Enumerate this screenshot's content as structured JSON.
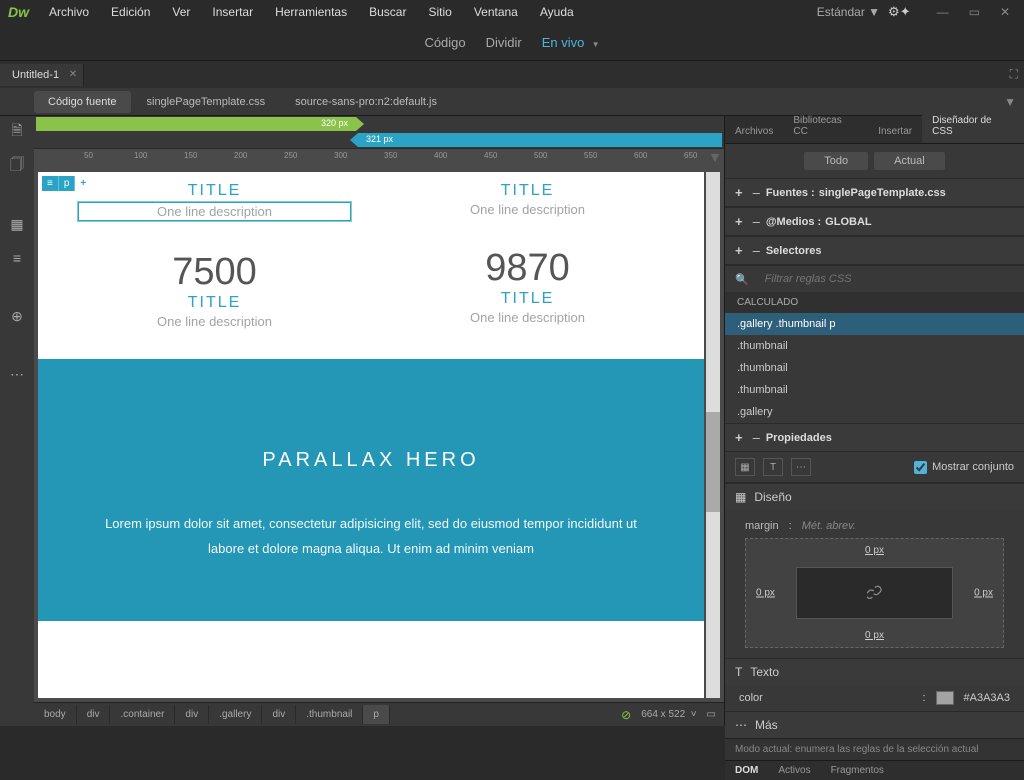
{
  "app": {
    "logo": "Dw"
  },
  "menu": {
    "items": [
      "Archivo",
      "Edición",
      "Ver",
      "Insertar",
      "Herramientas",
      "Buscar",
      "Sitio",
      "Ventana",
      "Ayuda"
    ],
    "workspace": "Estándar"
  },
  "view_modes": {
    "code": "Código",
    "split": "Dividir",
    "live": "En vivo"
  },
  "document": {
    "tab": "Untitled-1",
    "related": {
      "source": "Código fuente",
      "files": [
        "singlePageTemplate.css",
        "source-sans-pro:n2:default.js"
      ]
    }
  },
  "breakpoints": {
    "green": "320  px",
    "cyan": "321  px"
  },
  "ruler_ticks": [
    50,
    100,
    150,
    200,
    250,
    300,
    350,
    400,
    450,
    500,
    550,
    600,
    650
  ],
  "element_chip": {
    "icon": "≡",
    "tag": "p",
    "add": "+"
  },
  "page": {
    "cols": [
      {
        "title": "TITLE",
        "desc": "One line description",
        "num": "7500",
        "title2": "TITLE",
        "desc2": "One line description"
      },
      {
        "title": "TITLE",
        "desc": "One line description",
        "num": "9870",
        "title2": "TITLE",
        "desc2": "One line description"
      }
    ],
    "hero": {
      "title": "PARALLAX HERO",
      "text": "Lorem ipsum dolor sit amet, consectetur adipisicing elit, sed do eiusmod tempor incididunt ut labore et dolore magna aliqua. Ut enim ad minim veniam"
    }
  },
  "breadcrumbs": [
    "body",
    "div",
    ".container",
    "div",
    ".gallery",
    "div",
    ".thumbnail",
    "p"
  ],
  "status": {
    "size": "664 x 522"
  },
  "panels": {
    "tabs": [
      "Archivos",
      "Bibliotecas CC",
      "Insertar",
      "Diseñador de CSS"
    ],
    "sub_tabs": [
      "Todo",
      "Actual"
    ],
    "sources": {
      "label": "Fuentes :",
      "value": "singlePageTemplate.css"
    },
    "media": {
      "label": "@Medios :",
      "value": "GLOBAL"
    },
    "selectors": {
      "label": "Selectores",
      "filter": "Filtrar reglas CSS",
      "computed": "CALCULADO",
      "items": [
        ".gallery .thumbnail p",
        ".thumbnail",
        ".thumbnail",
        ".thumbnail",
        ".gallery"
      ]
    },
    "properties": {
      "label": "Propiedades",
      "show_set": "Mostrar conjunto"
    },
    "design": {
      "label": "Diseño",
      "margin": "margin",
      "abbrev": "Mét. abrev.",
      "top": "0 px",
      "right": "0 px",
      "bottom": "0 px",
      "left": "0 px"
    },
    "text": {
      "label": "Texto",
      "color_label": "color",
      "color_value": "#A3A3A3"
    },
    "more": {
      "label": "Más"
    },
    "mode_note": "Modo actual: enumera las reglas de la selección actual",
    "bottom_tabs": [
      "DOM",
      "Activos",
      "Fragmentos"
    ]
  }
}
